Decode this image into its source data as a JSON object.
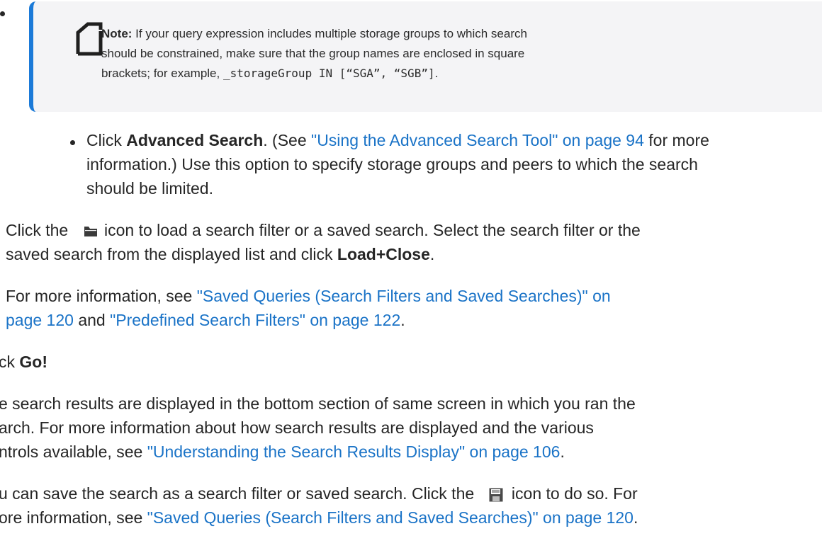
{
  "note": {
    "label": "Note:",
    "text_1": " If your query expression includes multiple storage groups to which search",
    "text_2": "should be constrained, make sure that the group names are enclosed in square",
    "text_3a": "brackets; for example, ",
    "code": "_storageGroup IN [“SGA”, “SGB”]",
    "text_3b": "."
  },
  "advanced": {
    "pre": "Click ",
    "bold": "Advanced Search",
    "mid": ". (See ",
    "link": "\"Using the Advanced Search Tool\" on page 94",
    "post": " for more",
    "line2": "information.) Use this option to specify storage groups and peers to which the search",
    "line3": "should be limited."
  },
  "load": {
    "pre": "Click the ",
    "post": " icon to load a search filter or a saved search. Select the search filter or the",
    "line2_pre": "saved search from the displayed list and click ",
    "line2_bold": "Load+Close",
    "line2_post": "."
  },
  "more_info": {
    "pre": "For more information, see ",
    "link1": "\"Saved Queries (Search Filters and Saved Searches)\" on",
    "link1b": "page 120",
    "mid": " and ",
    "link2": "\"Predefined Search Filters\" on page 122",
    "post": "."
  },
  "go": {
    "pre": "ck ",
    "bold": "Go!"
  },
  "results": {
    "line1": "e search results are displayed in the bottom section of same screen in which you ran the",
    "line2": "arch. For more information about how search results are displayed and the various",
    "line3_pre": "ntrols available, see ",
    "line3_link": "\"Understanding the Search Results Display\" on page 106",
    "line3_post": "."
  },
  "save": {
    "line1_pre": "u can save the search as a search filter or saved search. Click the ",
    "line1_post": " icon to do so. For",
    "line2_pre": "ore information, see ",
    "line2_link": "\"Saved Queries (Search Filters and Saved Searches)\" on page 120",
    "line2_post": "."
  },
  "icons": {
    "note": "note-icon",
    "folder": "folder-icon",
    "save": "save-icon"
  },
  "colors": {
    "link": "#1a73c7",
    "accent": "#1b7ad8",
    "note_bg": "#f4f4f6"
  }
}
